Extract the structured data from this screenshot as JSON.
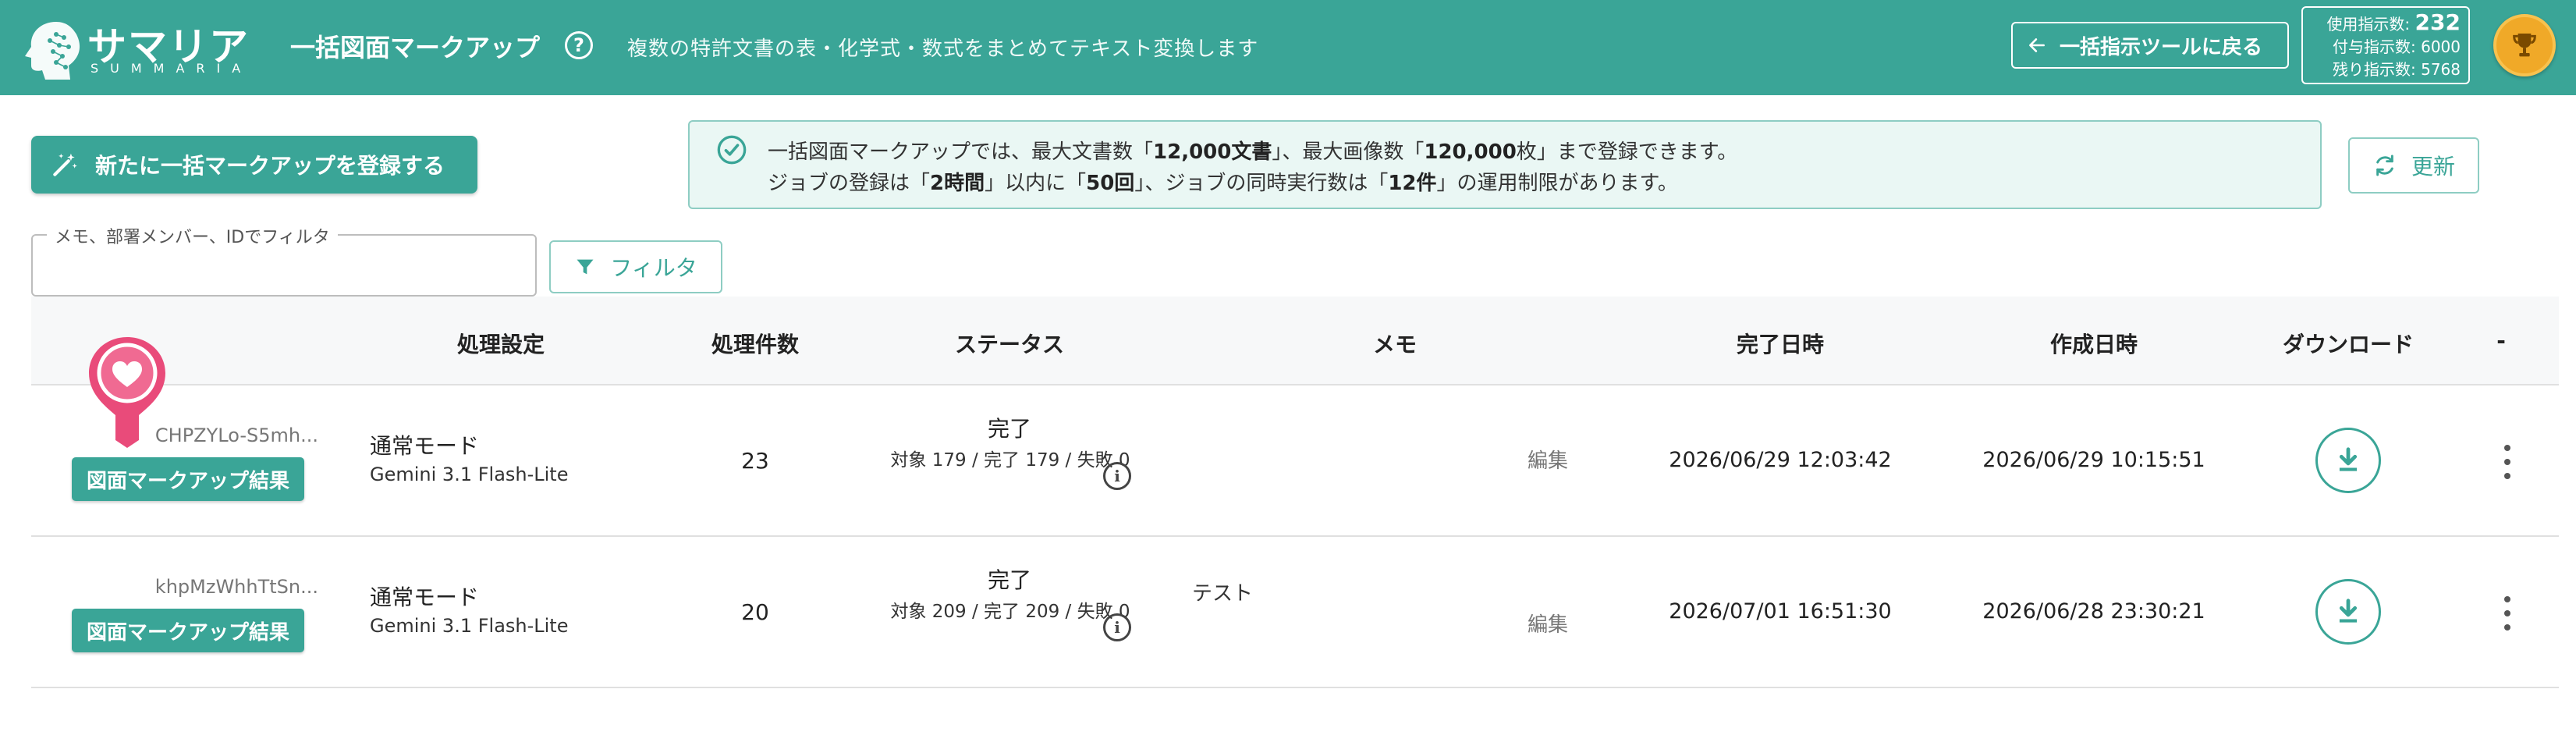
{
  "app": {
    "logo_jp": "サマリア",
    "logo_en": "SUMMARIA",
    "title": "一括図面マークアップ",
    "subtitle": "複数の特許文書の表・化学式・数式をまとめてテキスト変換します"
  },
  "header": {
    "back_label": "一括指示ツールに戻る",
    "usage": {
      "used_label": "使用指示数:",
      "used_value": "232",
      "granted_label": "付与指示数:",
      "granted_value": "6000",
      "remaining_label": "残り指示数:",
      "remaining_value": "5768"
    }
  },
  "toolbar": {
    "register_label": "新たに一括マークアップを登録する",
    "refresh_label": "更新",
    "filter_legend": "メモ、部署メンバー、IDでフィルタ",
    "filter_value": "",
    "filter_button": "フィルタ"
  },
  "notice": {
    "l1_a": "一括図面マークアップでは、最大文書数「",
    "l1_b": "12,000文書",
    "l1_c": "」、最大画像数「",
    "l1_d": "120,000",
    "l1_e": "枚」まで登録できます。",
    "l2_a": "ジョブの登録は「",
    "l2_b": "2時間",
    "l2_c": "」以内に「",
    "l2_d": "50回",
    "l2_e": "」、ジョブの同時実行数は「",
    "l2_f": "12件",
    "l2_g": "」の運用制限があります。"
  },
  "table": {
    "headers": {
      "setting": "処理設定",
      "count": "処理件数",
      "status": "ステータス",
      "memo": "メモ",
      "done": "完了日時",
      "created": "作成日時",
      "download": "ダウンロード",
      "more": "-"
    },
    "rows": [
      {
        "id": "CHPZYLo-S5mh...",
        "result_label": "図面マークアップ結果",
        "mode": "通常モード",
        "model": "Gemini 3.1 Flash-Lite",
        "count": "23",
        "status": "完了",
        "status_detail": "対象 179 / 完了 179 / 失敗 0",
        "memo": "",
        "edit_label": "編集",
        "done_at": "2026/06/29 12:03:42",
        "created_at": "2026/06/29 10:15:51"
      },
      {
        "id": "khpMzWhhTtSn...",
        "result_label": "図面マークアップ結果",
        "mode": "通常モード",
        "model": "Gemini 3.1 Flash-Lite",
        "count": "20",
        "status": "完了",
        "status_detail": "対象 209 / 完了 209 / 失敗 0",
        "memo": "テスト",
        "edit_label": "編集",
        "done_at": "2026/07/01 16:51:30",
        "created_at": "2026/06/28 23:30:21"
      }
    ]
  },
  "colors": {
    "primary": "#3aa597",
    "notice_bg": "#eaf7f4",
    "trophy": "#f0a928",
    "favorite_pink": "#e94b7a"
  },
  "icons": {
    "help": "question-circle-icon",
    "back": "arrow-left-icon",
    "trophy": "trophy-icon",
    "register": "magic-wand-icon",
    "notice": "check-circle-icon",
    "refresh": "refresh-icon",
    "filter": "funnel-icon",
    "info": "info-circle-icon",
    "download": "download-icon",
    "more": "more-vertical-icon",
    "favorite": "heart-pin-icon"
  }
}
